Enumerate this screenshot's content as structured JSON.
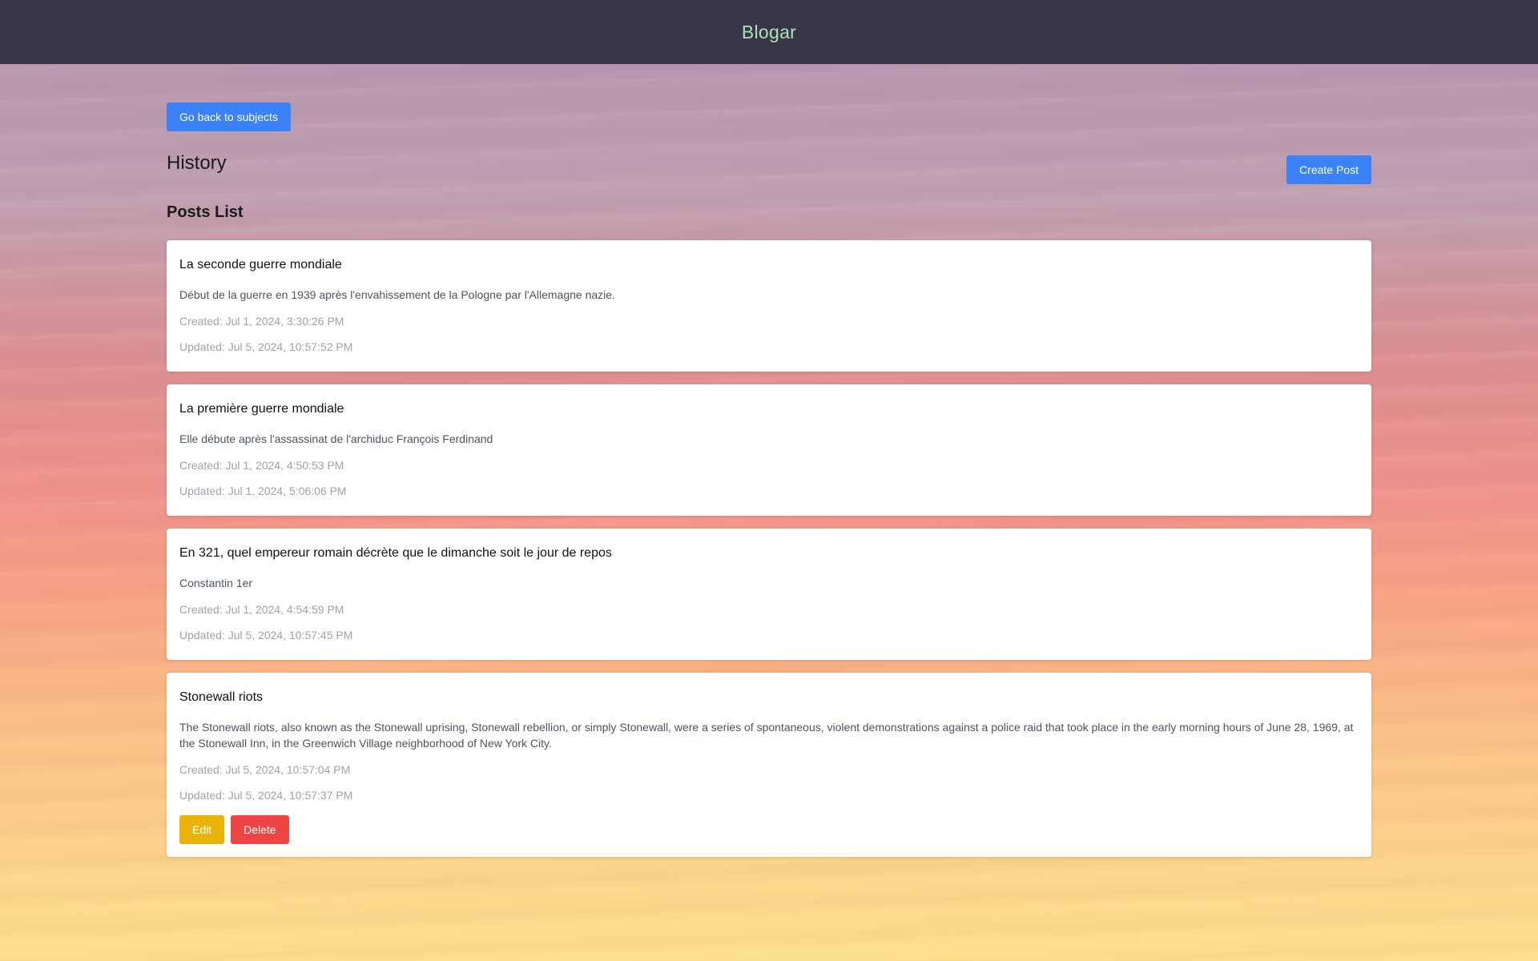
{
  "navbar": {
    "brand": "Blogar"
  },
  "page": {
    "back_button": "Go back to subjects",
    "subject_title": "History",
    "create_button": "Create Post",
    "list_heading": "Posts List"
  },
  "posts": [
    {
      "title": "La seconde guerre mondiale",
      "body": "Début de la guerre en 1939 après l'envahissement de la Pologne par l'Allemagne nazie.",
      "created": "Created: Jul 1, 2024, 3:30:26 PM",
      "updated": "Updated: Jul 5, 2024, 10:57:52 PM"
    },
    {
      "title": "La première guerre mondiale",
      "body": "Elle débute après l'assassinat de l'archiduc François Ferdinand",
      "created": "Created: Jul 1, 2024, 4:50:53 PM",
      "updated": "Updated: Jul 1, 2024, 5:06:06 PM"
    },
    {
      "title": "En 321, quel empereur romain décrète que le dimanche soit le jour de repos",
      "body": "Constantin 1er",
      "created": "Created: Jul 1, 2024, 4:54:59 PM",
      "updated": "Updated: Jul 5, 2024, 10:57:45 PM"
    },
    {
      "title": "Stonewall riots",
      "body": "The Stonewall riots, also known as the Stonewall uprising, Stonewall rebellion, or simply Stonewall, were a series of spontaneous, violent demonstrations against a police raid that took place in the early morning hours of June 28, 1969, at the Stonewall Inn, in the Greenwich Village neighborhood of New York City.",
      "created": "Created: Jul 5, 2024, 10:57:04 PM",
      "updated": "Updated: Jul 5, 2024, 10:57:37 PM",
      "edit_label": "Edit",
      "delete_label": "Delete"
    }
  ],
  "colors": {
    "navbar_bg": "#393646",
    "brand": "#a7e3b9",
    "primary": "#3b82f6",
    "edit": "#eab308",
    "delete": "#ef4444"
  }
}
